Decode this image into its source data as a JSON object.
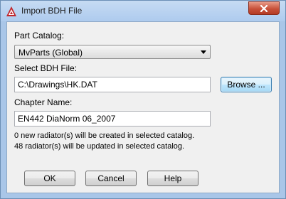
{
  "window": {
    "title": "Import BDH File"
  },
  "icons": {
    "app": "autocad-logo-icon",
    "close": "close-icon",
    "dropdown": "chevron-down-icon"
  },
  "colors": {
    "close_button": "#c8513a",
    "title_bar": "#aecbee",
    "client_bg": "#f0f0f0"
  },
  "part_catalog": {
    "label": "Part Catalog:",
    "value": "MvParts (Global)"
  },
  "bdh_file": {
    "label": "Select BDH File:",
    "value": "C:\\Drawings\\HK.DAT",
    "browse_label": "Browse ..."
  },
  "chapter": {
    "label": "Chapter Name:",
    "value": "EN442 DiaNorm 06_2007"
  },
  "info": {
    "line1": "0 new radiator(s) will be created in selected catalog.",
    "line2": "48 radiator(s) will be updated in selected catalog."
  },
  "buttons": {
    "ok": "OK",
    "cancel": "Cancel",
    "help": "Help"
  }
}
